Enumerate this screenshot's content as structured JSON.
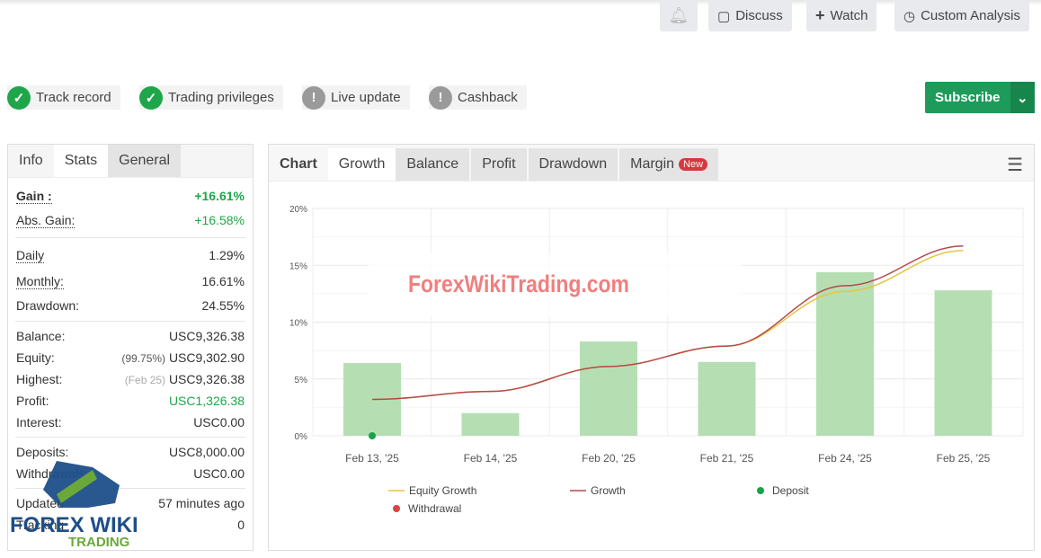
{
  "toolbar": {
    "discuss": "Discuss",
    "watch": "Watch",
    "custom_analysis": "Custom Analysis"
  },
  "badges": [
    {
      "label": "Track record",
      "status": "ok"
    },
    {
      "label": "Trading privileges",
      "status": "ok"
    },
    {
      "label": "Live update",
      "status": "warn"
    },
    {
      "label": "Cashback",
      "status": "warn"
    }
  ],
  "subscribe": "Subscribe",
  "left_tabs": [
    "Info",
    "Stats",
    "General"
  ],
  "stats": {
    "gain": {
      "label": "Gain :",
      "value": "+16.61%"
    },
    "abs_gain": {
      "label": "Abs. Gain:",
      "value": "+16.58%"
    },
    "daily": {
      "label": "Daily",
      "value": "1.29%"
    },
    "monthly": {
      "label": "Monthly:",
      "value": "16.61%"
    },
    "drawdown": {
      "label": "Drawdown:",
      "value": "24.55%"
    },
    "balance": {
      "label": "Balance:",
      "value": "USC9,326.38"
    },
    "equity": {
      "label": "Equity:",
      "note": "(99.75%)",
      "value": "USC9,302.90"
    },
    "highest": {
      "label": "Highest:",
      "note": "(Feb 25)",
      "value": "USC9,326.38"
    },
    "profit": {
      "label": "Profit:",
      "value": "USC1,326.38"
    },
    "interest": {
      "label": "Interest:",
      "value": "USC0.00"
    },
    "deposits": {
      "label": "Deposits:",
      "value": "USC8,000.00"
    },
    "withdrawals": {
      "label": "Withdrawals:",
      "value": "USC0.00"
    },
    "updated": {
      "label": "Updated",
      "value": "57 minutes ago"
    },
    "tracking": {
      "label": "Tracking",
      "value": "0"
    }
  },
  "chart_tabs": [
    "Chart",
    "Growth",
    "Balance",
    "Profit",
    "Drawdown",
    "Margin"
  ],
  "new_badge": "New",
  "watermark": "ForexWikiTrading.com",
  "logo": {
    "line1": "FOREX WIKI",
    "line2": "TRADING"
  },
  "chart_data": {
    "type": "bar",
    "categories": [
      "Feb 13, '25",
      "Feb 14, '25",
      "Feb 20, '25",
      "Feb 21, '25",
      "Feb 24, '25",
      "Feb 25, '25"
    ],
    "yticks": [
      "0%",
      "5%",
      "10%",
      "15%",
      "20%"
    ],
    "ylim": [
      0,
      20
    ],
    "values": [
      6.4,
      2.0,
      8.3,
      6.5,
      14.4,
      12.8
    ],
    "series": [
      {
        "name": "Equity Growth",
        "color": "#e8c440",
        "values": [
          3.2,
          3.9,
          6.1,
          7.9,
          12.7,
          16.3
        ]
      },
      {
        "name": "Growth",
        "color": "#b5494a",
        "values": [
          3.2,
          3.9,
          6.1,
          7.9,
          13.2,
          16.7
        ]
      }
    ],
    "deposit_points": [
      {
        "x": "Feb 13, '25",
        "y": 0
      }
    ],
    "legend": [
      {
        "name": "Equity Growth",
        "color": "#e8c440",
        "kind": "line"
      },
      {
        "name": "Growth",
        "color": "#b5494a",
        "kind": "line"
      },
      {
        "name": "Deposit",
        "color": "#17a34a",
        "kind": "dot"
      },
      {
        "name": "Withdrawal",
        "color": "#d94444",
        "kind": "dot"
      }
    ],
    "bar_color": "#b5dfb3"
  }
}
